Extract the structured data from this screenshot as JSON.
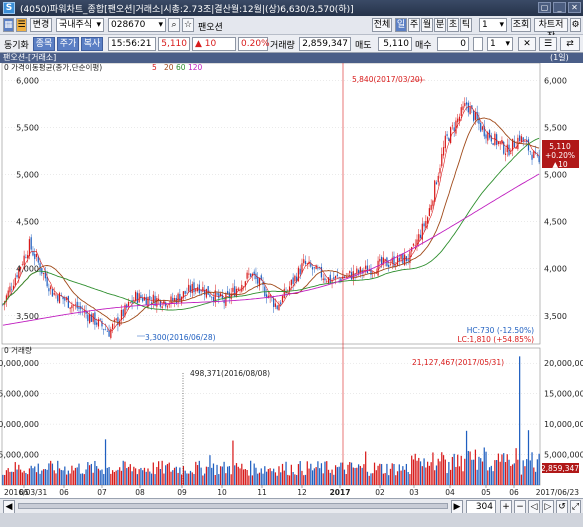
{
  "window": {
    "icon": "S",
    "title": "(4050)파워차트_종합[팬오션|거래소|시총:2.73조|결산월:12월|(상)6,630/3,570(하)]",
    "buttons": [
      "▢",
      "_",
      "✕"
    ]
  },
  "toolbar1": {
    "view_button": "변경",
    "market_select": "국내주식",
    "code_input": "028670",
    "stock_name": "팬오션",
    "period_buttons": [
      "전체",
      "일",
      "주",
      "월",
      "분",
      "초",
      "틱"
    ],
    "period_active": "일",
    "count_input": "1",
    "query_button": "조회",
    "save_button": "차트저장"
  },
  "toolbar2": {
    "sync_label": "동기화",
    "tabs": [
      "종목",
      "주가",
      "복사"
    ],
    "time": "15:56:21",
    "price": "5,110",
    "change": "▲ 10",
    "change_pct": "0.20%",
    "volume_label": "거래량",
    "volume": "2,859,347",
    "ask_label": "매도",
    "ask_price": "5,110",
    "bid_label": "매수",
    "bid_qty": "0",
    "spin_value": "1",
    "right_buttons": [
      "✕",
      "☰",
      "⇄"
    ]
  },
  "panel": {
    "title": "팬오션-[거래소]",
    "period": "(1일)"
  },
  "price_chart": {
    "legend_prefix": "가격이동평균(종가,단순이평)",
    "ma_periods": [
      "5",
      "20",
      "60",
      "120"
    ],
    "ma_colors": [
      "#d81b1b",
      "#a04a1a",
      "#2f8f2f",
      "#c020c0"
    ],
    "y_ticks": [
      "6,000",
      "5,500",
      "5,000",
      "4,500",
      "4,000",
      "3,500"
    ],
    "high_annotation": "5,840(2017/03/20)",
    "low_annotation": "3,300(2016/06/28)",
    "hc_text": "HC:730 (-12.50%)",
    "lc_text": "LC:1,810 (+54.85%)",
    "price_tag": [
      "5,110",
      "+0.20%",
      "▲10"
    ]
  },
  "volume_chart": {
    "title": "거래량",
    "y_ticks": [
      "20,000,000",
      "15,000,000",
      "10,000,000",
      "5,000,000"
    ],
    "max_annotation": "21,127,467(2017/05/31)",
    "min_annotation": "498,371(2016/08/08)",
    "last_tag": "2,859,347"
  },
  "x_axis": {
    "start_date": "2016/03/31",
    "end_date": "2017/06/23",
    "month_labels": [
      "05",
      "06",
      "07",
      "08",
      "09",
      "10",
      "11",
      "12",
      "2017",
      "02",
      "03",
      "04",
      "05",
      "06"
    ]
  },
  "scroll": {
    "count": "304"
  },
  "colors": {
    "up": "#d81b1b",
    "down": "#1f5fc0",
    "header": "#4a5e88",
    "ma120": "#c020c0"
  }
}
